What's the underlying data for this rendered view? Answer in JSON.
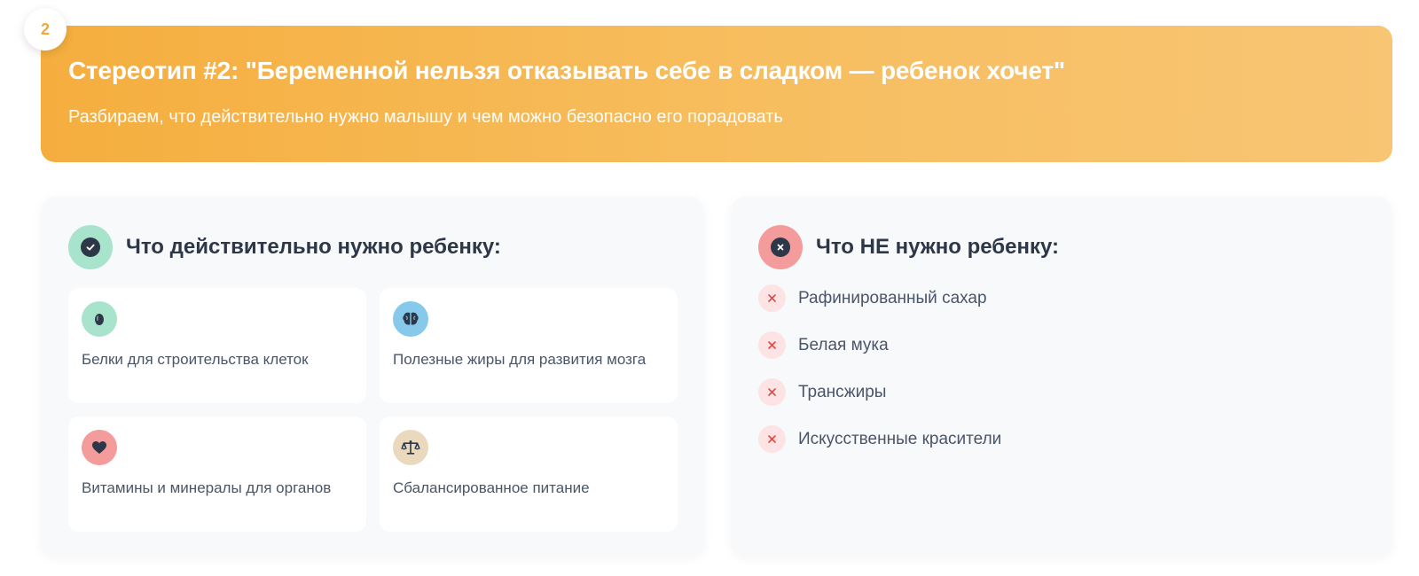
{
  "badge": {
    "number": "2"
  },
  "hero": {
    "title": "Стереотип #2: \"Беременной нельзя отказывать себе в сладком — ребенок хочет\"",
    "subtitle": "Разбираем, что действительно нужно малышу и чем можно безопасно его порадовать",
    "gradient_colors": [
      "#f5ae3e",
      "#f8c574"
    ]
  },
  "needed": {
    "title": "Что действительно нужно ребенку:",
    "icon": "check-circle-icon",
    "items": [
      {
        "label": "Белки для строительства клеток",
        "icon": "egg-icon",
        "color": "#a8e3cc"
      },
      {
        "label": "Полезные жиры для развития мозга",
        "icon": "brain-icon",
        "color": "#87c9ea"
      },
      {
        "label": "Витамины и минералы для органов",
        "icon": "heart-icon",
        "color": "#f49c9c"
      },
      {
        "label": "Сбалансированное питание",
        "icon": "scale-balance-icon",
        "color": "#ead9bd"
      }
    ]
  },
  "not_needed": {
    "title": "Что НЕ нужно ребенку:",
    "icon": "x-circle-icon",
    "items": [
      {
        "label": "Рафинированный сахар",
        "icon": "x-mark-icon"
      },
      {
        "label": "Белая мука",
        "icon": "x-mark-icon"
      },
      {
        "label": "Трансжиры",
        "icon": "x-mark-icon"
      },
      {
        "label": "Искусственные красители",
        "icon": "x-mark-icon"
      }
    ]
  },
  "colors": {
    "accent": "#f5ae3e",
    "dark": "#2d3748",
    "text": "#4a5568",
    "danger": "#e04848"
  }
}
